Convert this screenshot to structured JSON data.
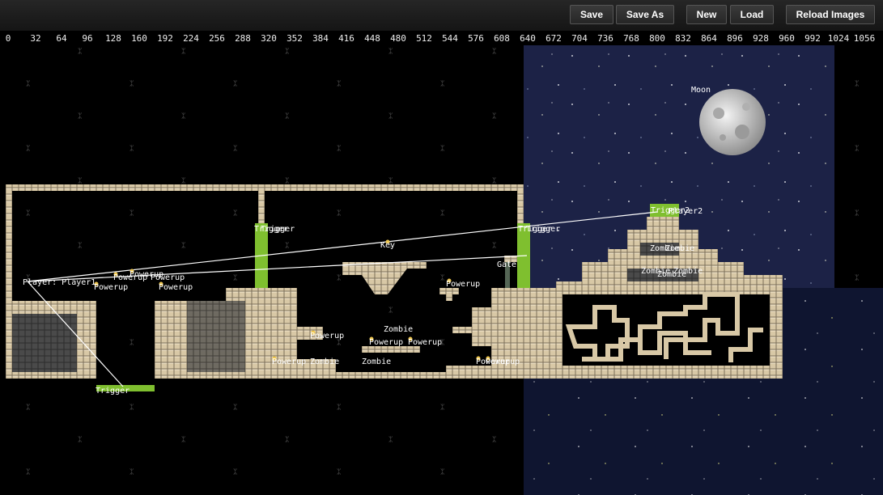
{
  "toolbar": {
    "save": "Save",
    "save_as": "Save As",
    "new": "New",
    "load": "Load",
    "reload_images": "Reload Images"
  },
  "ruler": {
    "ticks": [
      "0",
      "32",
      "64",
      "96",
      "128",
      "160",
      "192",
      "224",
      "256",
      "288",
      "320",
      "352",
      "384",
      "416",
      "448",
      "480",
      "512",
      "544",
      "576",
      "608",
      "640",
      "672",
      "704",
      "736",
      "768",
      "800",
      "832",
      "864",
      "896",
      "928",
      "960",
      "992",
      "1024",
      "1056"
    ]
  },
  "entities": {
    "player_label": "Player: Player1",
    "moon": "Moon",
    "trigger": "Trigger",
    "trigger2": "Trigger2",
    "player2": "Player2",
    "key": "Key",
    "gate": "Gate",
    "powerup": "Powerup",
    "zombie": "Zombie"
  },
  "colors": {
    "trigger_green": "#7fbf2f",
    "tile_tan": "#d8c8a6",
    "tile_dark": "#4a4a4a",
    "sky_blue": "#1c2246"
  }
}
